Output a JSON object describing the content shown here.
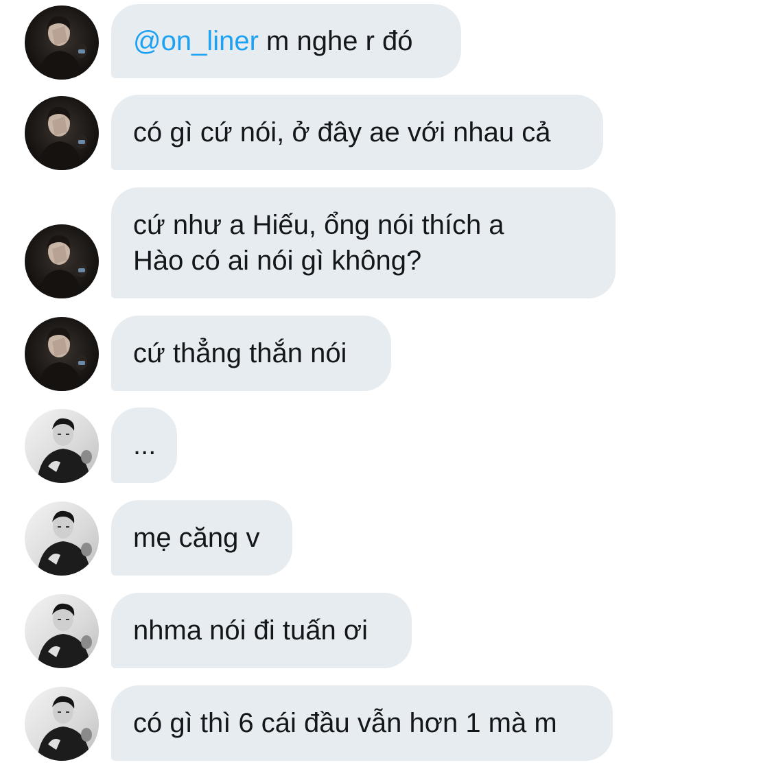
{
  "colors": {
    "bubble_bg": "#e6ecf0",
    "text": "#14171a",
    "mention": "#1da1f2"
  },
  "messages": [
    {
      "sender": "user-a",
      "avatar_icon": "profile-photo-dark-icon",
      "mention": "@on_liner",
      "text": " m nghe r đó"
    },
    {
      "sender": "user-a",
      "avatar_icon": "profile-photo-dark-icon",
      "text": "có gì cứ nói, ở đây ae với nhau cả"
    },
    {
      "sender": "user-a",
      "avatar_icon": "profile-photo-dark-icon",
      "text_lines": [
        "cứ như a Hiếu, ổng nói thích a",
        "Hào có ai nói gì không?"
      ]
    },
    {
      "sender": "user-a",
      "avatar_icon": "profile-photo-dark-icon",
      "text": "cứ thẳng thắn nói"
    },
    {
      "sender": "user-b",
      "avatar_icon": "profile-photo-bw-icon",
      "text": "..."
    },
    {
      "sender": "user-b",
      "avatar_icon": "profile-photo-bw-icon",
      "text": "mẹ căng v"
    },
    {
      "sender": "user-b",
      "avatar_icon": "profile-photo-bw-icon",
      "text": "nhma nói đi tuấn ơi"
    },
    {
      "sender": "user-b",
      "avatar_icon": "profile-photo-bw-icon",
      "text": "có gì thì 6 cái đầu vẫn hơn 1 mà m"
    }
  ]
}
